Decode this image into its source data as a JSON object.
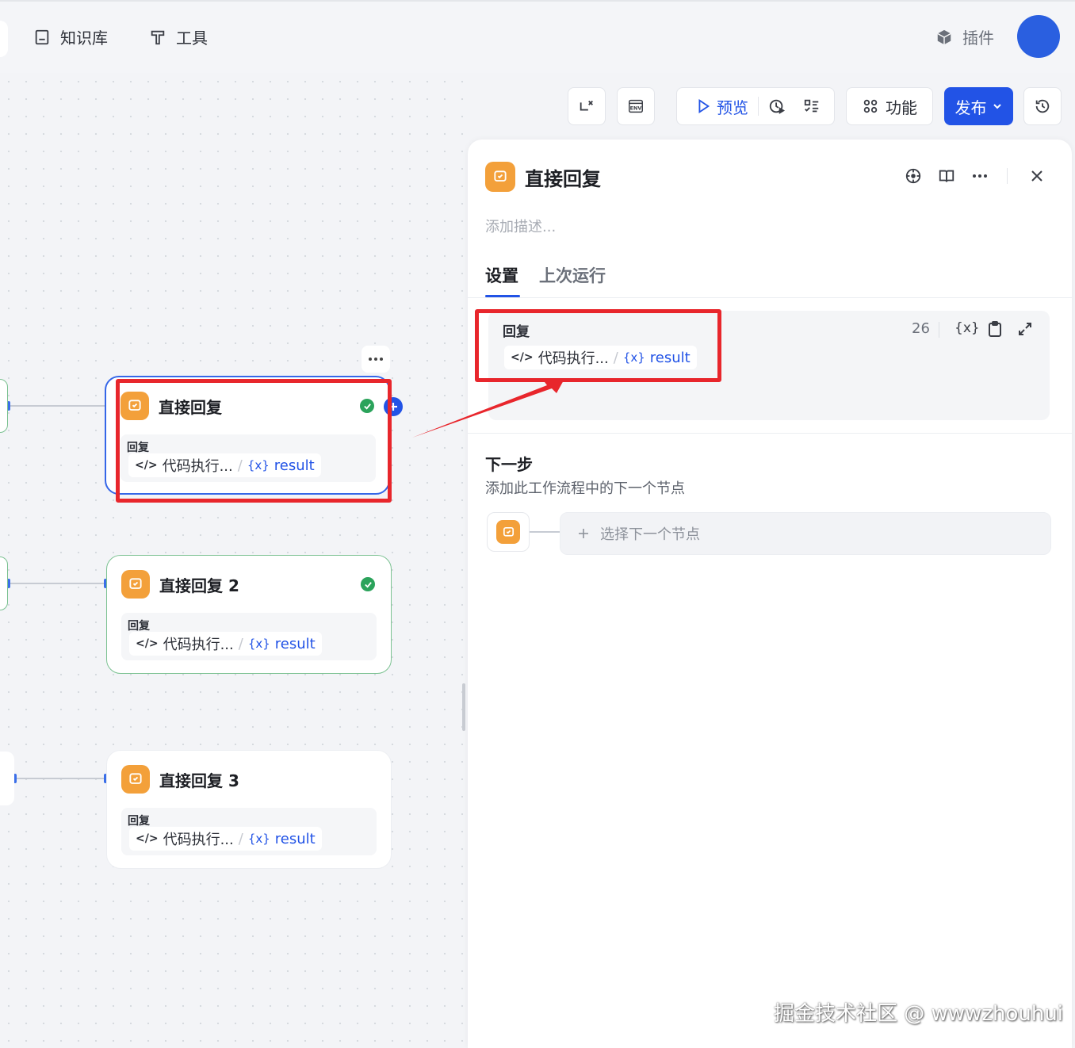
{
  "nav": {
    "knowledge_label": "知识库",
    "tools_label": "工具",
    "plugins_label": "插件"
  },
  "toolbar": {
    "env_label": "ENV",
    "preview_label": "预览",
    "features_label": "功能",
    "publish_label": "发布"
  },
  "nodes": [
    {
      "title": "直接回复",
      "body_label": "回复",
      "chip_source": "代码执行...",
      "chip_sep": "/",
      "chip_var": "result",
      "status": "success"
    },
    {
      "title": "直接回复 2",
      "body_label": "回复",
      "chip_source": "代码执行...",
      "chip_sep": "/",
      "chip_var": "result",
      "status": "success"
    },
    {
      "title": "直接回复 3",
      "body_label": "回复",
      "chip_source": "代码执行...",
      "chip_sep": "/",
      "chip_var": "result",
      "status": "none"
    }
  ],
  "panel": {
    "title": "直接回复",
    "description_placeholder": "添加描述...",
    "tabs": [
      {
        "label": "设置",
        "active": true
      },
      {
        "label": "上次运行",
        "active": false
      }
    ],
    "reply": {
      "label": "回复",
      "count": "26",
      "var_icon_label": "{x}",
      "chip_source": "代码执行...",
      "chip_sep": "/",
      "chip_var": "result"
    },
    "next_step": {
      "title": "下一步",
      "subtitle": "添加此工作流程中的下一个节点",
      "select_label": "选择下一个节点"
    }
  },
  "watermark": "掘金技术社区 @ wwwzhouhui",
  "colors": {
    "accent": "#2253e6",
    "node_icon": "#f3a03a",
    "success": "#2ba35b",
    "annotation_red": "#e8262c"
  }
}
